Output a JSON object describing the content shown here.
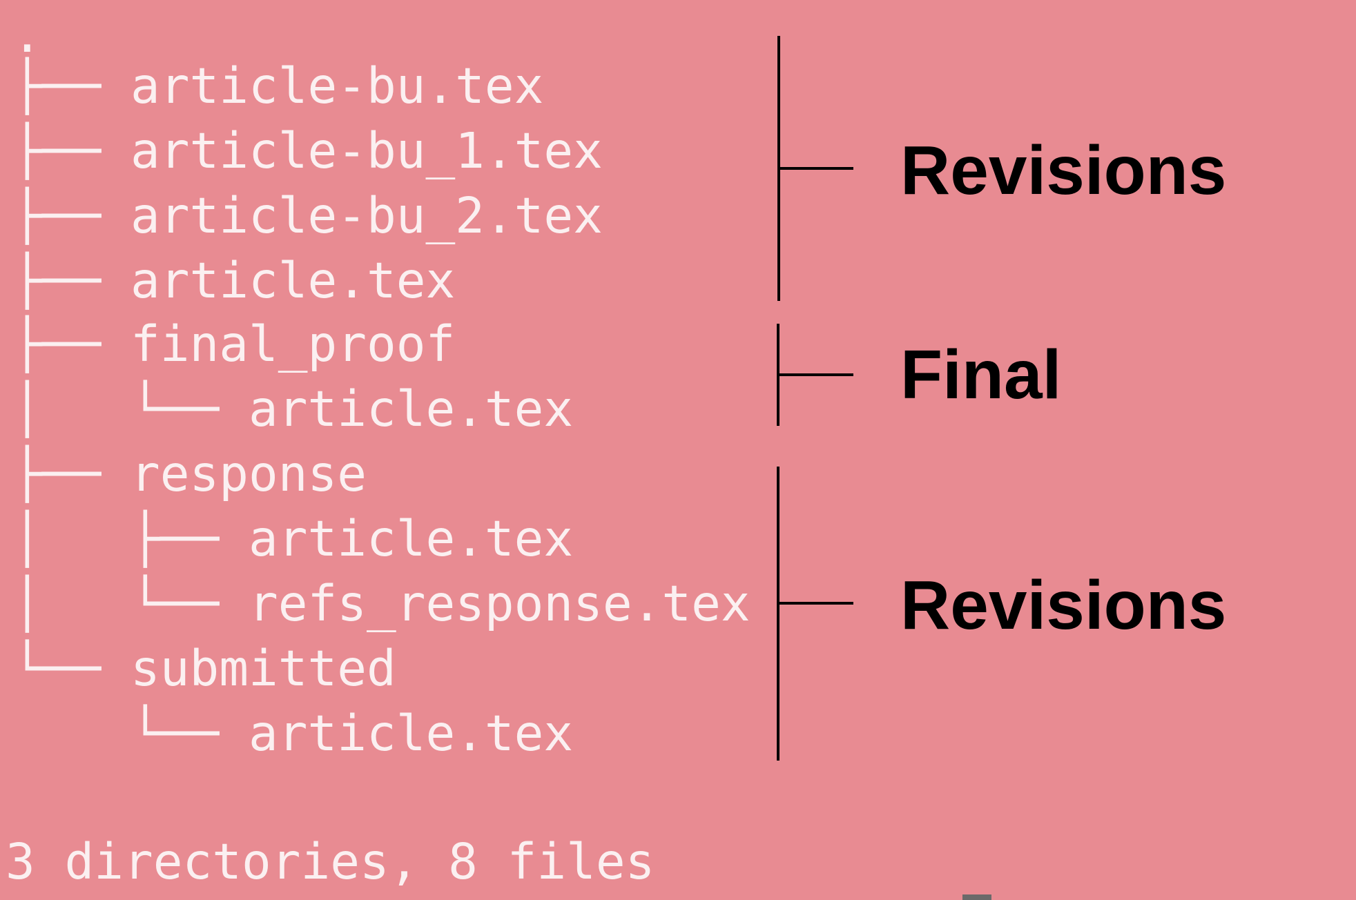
{
  "terminal": {
    "background": "#e88b92",
    "text_color": "#fbf0f1",
    "tree": [
      {
        "text": "."
      },
      {
        "text": "├── article-bu.tex"
      },
      {
        "text": "├── article-bu_1.tex"
      },
      {
        "text": "├── article-bu_2.tex"
      },
      {
        "text": "├── article.tex"
      },
      {
        "text": "├── final_proof"
      },
      {
        "text": "│   └── article.tex"
      },
      {
        "text": "├── response"
      },
      {
        "text": "│   ├── article.tex"
      },
      {
        "text": "│   └── refs_response.tex"
      },
      {
        "text": "└── submitted"
      },
      {
        "text": "    └── article.tex"
      }
    ],
    "summary": "3 directories, 8 files"
  },
  "annotations": [
    {
      "label": "Revisions"
    },
    {
      "label": "Final"
    },
    {
      "label": "Revisions"
    }
  ]
}
